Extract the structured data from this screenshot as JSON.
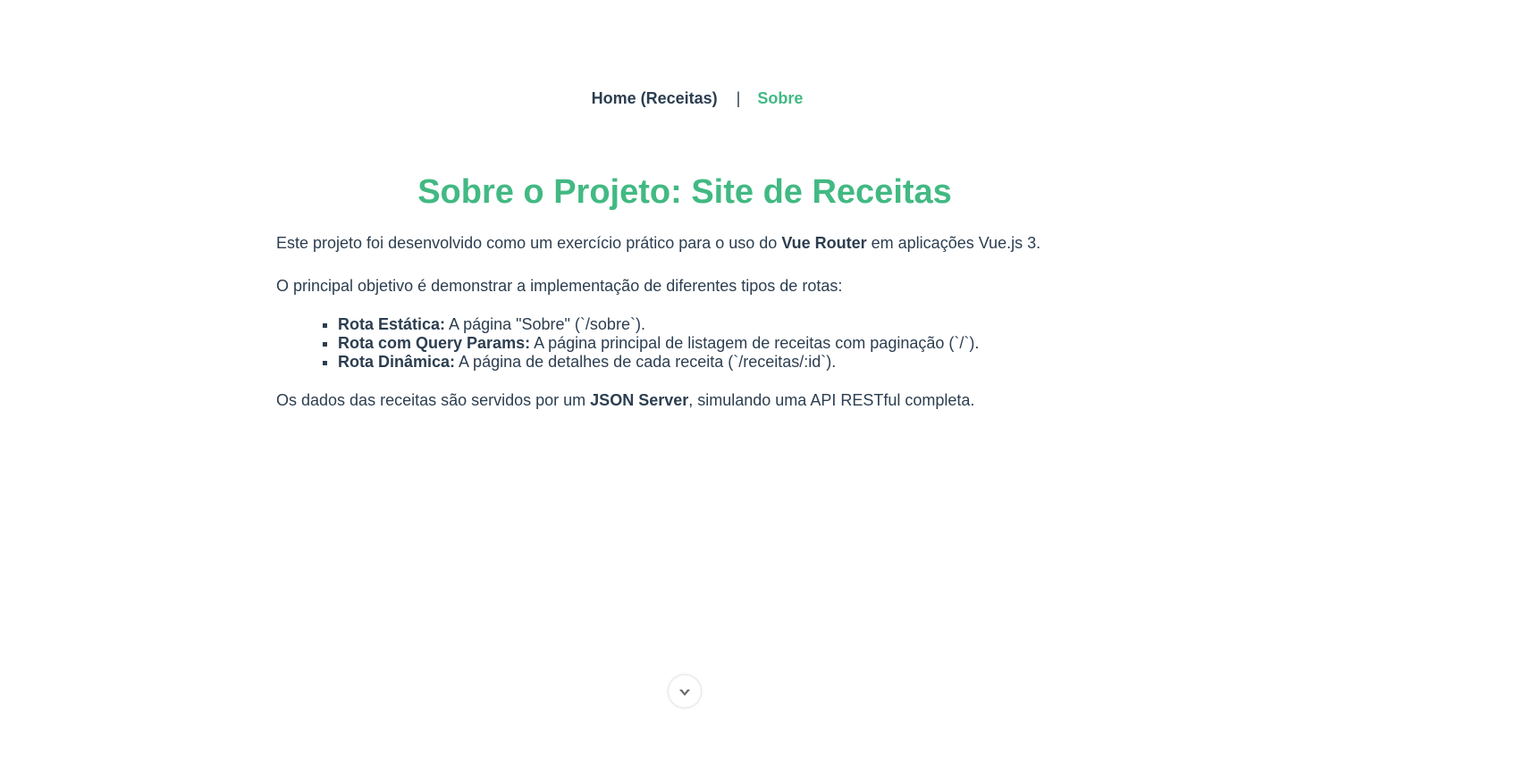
{
  "nav": {
    "home": "Home (Receitas)",
    "separator": "|",
    "about": "Sobre",
    "active_color": "#42b983"
  },
  "page": {
    "title": "Sobre o Projeto: Site de Receitas"
  },
  "content": {
    "p1_pre": "Este projeto foi desenvolvido como um exercício prático para o uso do ",
    "p1_bold": "Vue Router",
    "p1_post": " em aplicações Vue.js 3.",
    "p2": "O principal objetivo é demonstrar a implementação de diferentes tipos de rotas:",
    "items": [
      {
        "bold": "Rota Estática:",
        "text": " A página \"Sobre\" (`/sobre`)."
      },
      {
        "bold": "Rota com Query Params:",
        "text": " A página principal de listagem de receitas com paginação (`/`)."
      },
      {
        "bold": "Rota Dinâmica:",
        "text": " A página de detalhes de cada receita (`/receitas/:id`)."
      }
    ],
    "p3_pre": "Os dados das receitas são servidos por um ",
    "p3_bold": "JSON Server",
    "p3_post": ", simulando uma API RESTful completa."
  },
  "scroll_button": {
    "icon": "chevron-down-icon"
  }
}
